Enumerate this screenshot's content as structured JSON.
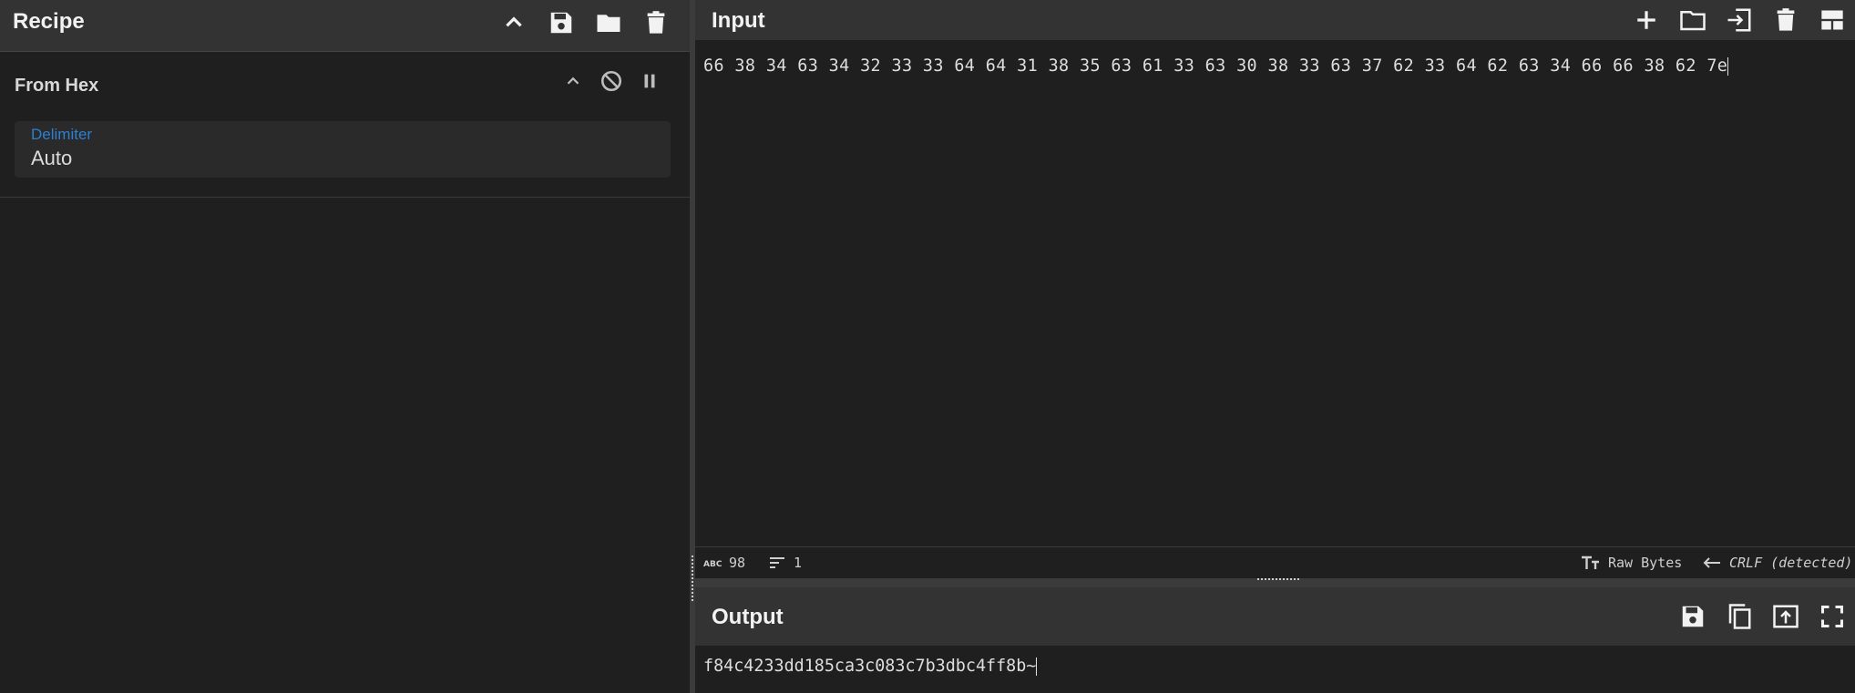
{
  "recipe": {
    "title": "Recipe",
    "header_icons": [
      "chevron-up-icon",
      "save-icon",
      "folder-icon",
      "trash-icon"
    ],
    "operation": {
      "name": "From Hex",
      "icons": [
        "chevron-up-icon",
        "disable-icon",
        "pause-icon"
      ],
      "delimiter_label": "Delimiter",
      "delimiter_value": "Auto"
    }
  },
  "input": {
    "title": "Input",
    "header_icons": [
      "plus-icon",
      "folder-icon",
      "input-file-icon",
      "trash-icon",
      "layout-icon"
    ],
    "text": "66 38 34 63 34 32 33 33 64 64 31 38 35 63 61 33 63 30 38 33 63 37 62 33 64 62 63 34 66 66 38 62 7e",
    "status": {
      "length": "98",
      "lines": "1",
      "encoding": "Raw Bytes",
      "eol": "CRLF (detected)"
    }
  },
  "output": {
    "title": "Output",
    "header_icons": [
      "save-icon",
      "copy-icon",
      "replace-input-icon",
      "fullscreen-icon"
    ],
    "text": "f84c4233dd185ca3c083c7b3dbc4ff8b~"
  },
  "colors": {
    "header_bg": "#333333",
    "body_bg": "#1f1f1f",
    "accent_blue": "#2f7fd1"
  }
}
